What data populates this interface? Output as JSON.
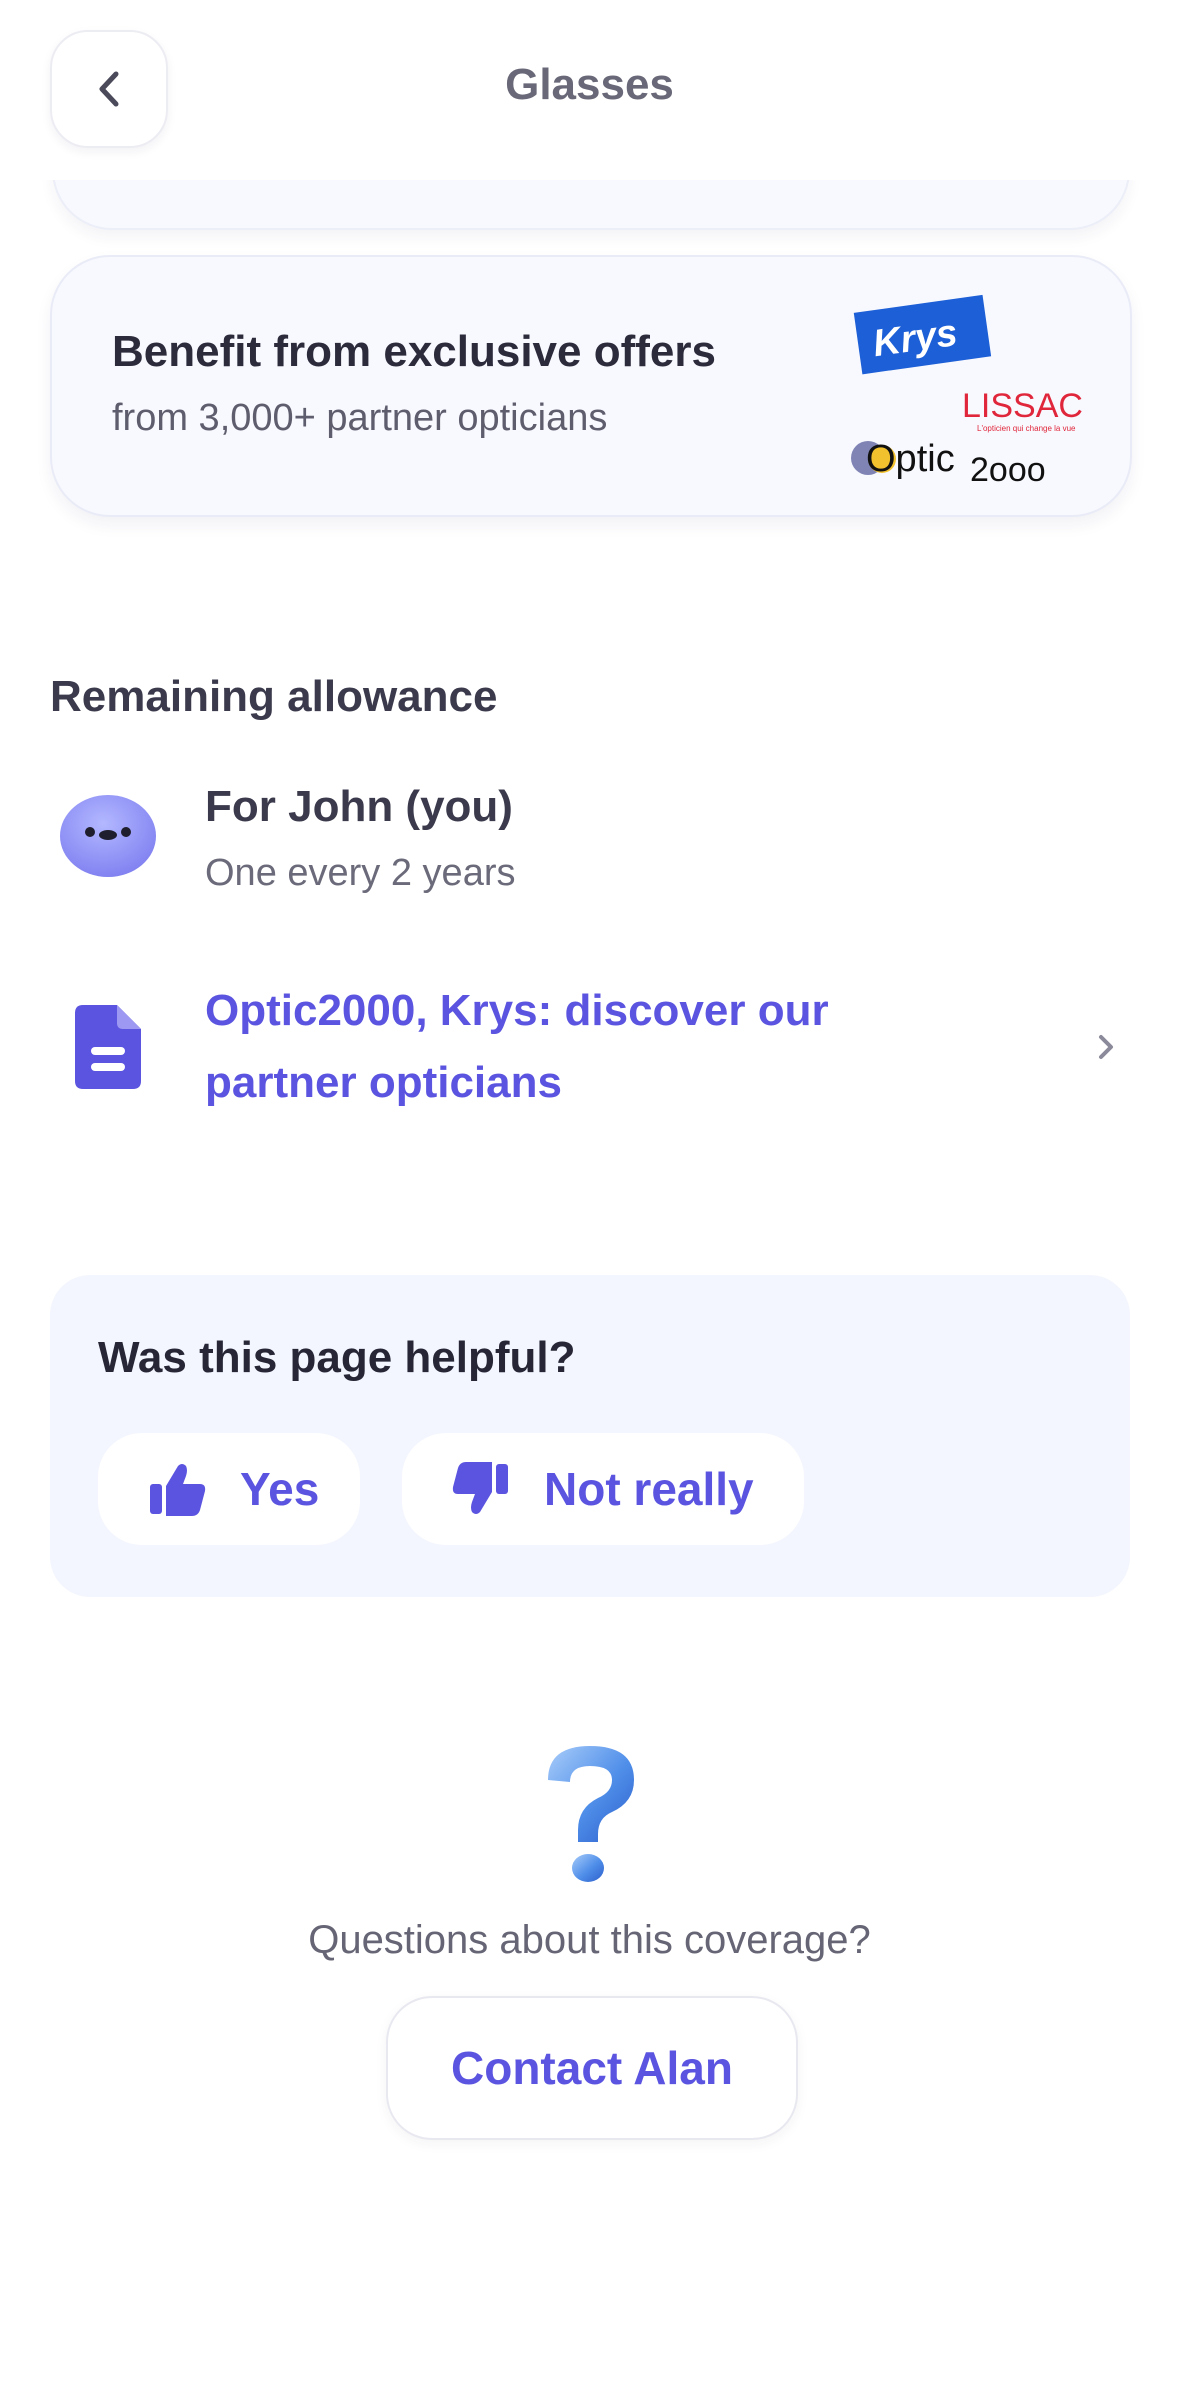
{
  "header": {
    "title": "Glasses"
  },
  "offer_card": {
    "title": "Benefit from exclusive offers",
    "subtitle": "from 3,000+ partner opticians",
    "logo_krys": "Krys",
    "logo_lissac": "LISSAC",
    "logo_lissac_tagline": "L'opticien qui change la vue",
    "logo_optic": "Optic",
    "logo_optic_num": "2ooo"
  },
  "allowance": {
    "section_title": "Remaining allowance",
    "person_name": "For John (you)",
    "person_detail": "One every 2 years"
  },
  "partner_link": {
    "label": "Optic2000, Krys: discover our partner opticians"
  },
  "feedback": {
    "title": "Was this page helpful?",
    "yes_label": "Yes",
    "no_label": "Not really"
  },
  "support": {
    "question": "Questions about this coverage?",
    "contact_label": "Contact Alan"
  },
  "colors": {
    "accent": "#5b54e0",
    "card_bg": "#f8f9fe",
    "feedback_bg": "#f3f6fe",
    "krys_blue": "#1d5fd6",
    "lissac_red": "#e0263b"
  },
  "icons": {
    "back": "chevron-left-icon",
    "avatar": "blob-avatar-icon",
    "document": "document-icon",
    "chevron": "chevron-right-icon",
    "thumbs_up": "thumbs-up-icon",
    "thumbs_down": "thumbs-down-icon",
    "question": "question-mark-icon"
  }
}
